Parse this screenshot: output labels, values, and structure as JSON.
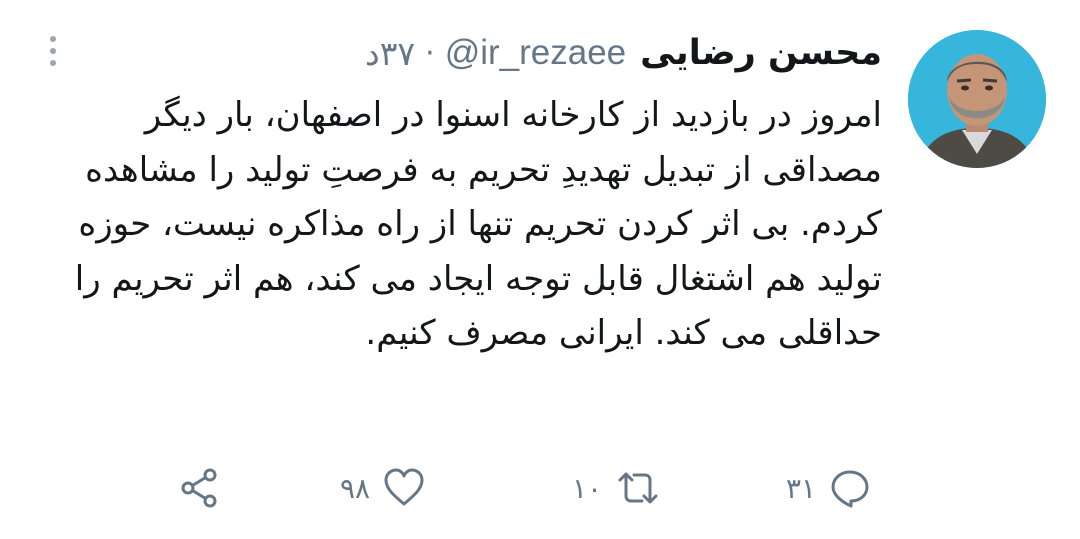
{
  "tweet": {
    "author_name": "محسن رضایی",
    "handle": "@ir_rezaee",
    "separator": "·",
    "time": "۳۷د",
    "text": "امروز در بازدید از کارخانه اسنوا در اصفهان، بار دیگر مصداقی از تبدیل تهدیدِ تحریم به فرصتِ تولید را مشاهده کردم. بی اثر کردن تحریم تنها از راه مذاکره نیست، حوزه تولید هم اشتغال قابل توجه ایجاد می کند، هم اثر تحریم را حداقلی می کند. ایرانی مصرف کنیم.",
    "avatar_icon": "profile-photo",
    "more_icon": "vertical-dots-icon"
  },
  "actions": {
    "reply": {
      "icon": "reply-bubble-icon",
      "count": "۳۱"
    },
    "retweet": {
      "icon": "retweet-arrows-icon",
      "count": "۱۰"
    },
    "like": {
      "icon": "heart-outline-icon",
      "count": "۹۸"
    },
    "share": {
      "icon": "share-icon"
    }
  },
  "colors": {
    "text": "#14171a",
    "secondary": "#657786",
    "avatar_bg": "#36b6dc"
  }
}
